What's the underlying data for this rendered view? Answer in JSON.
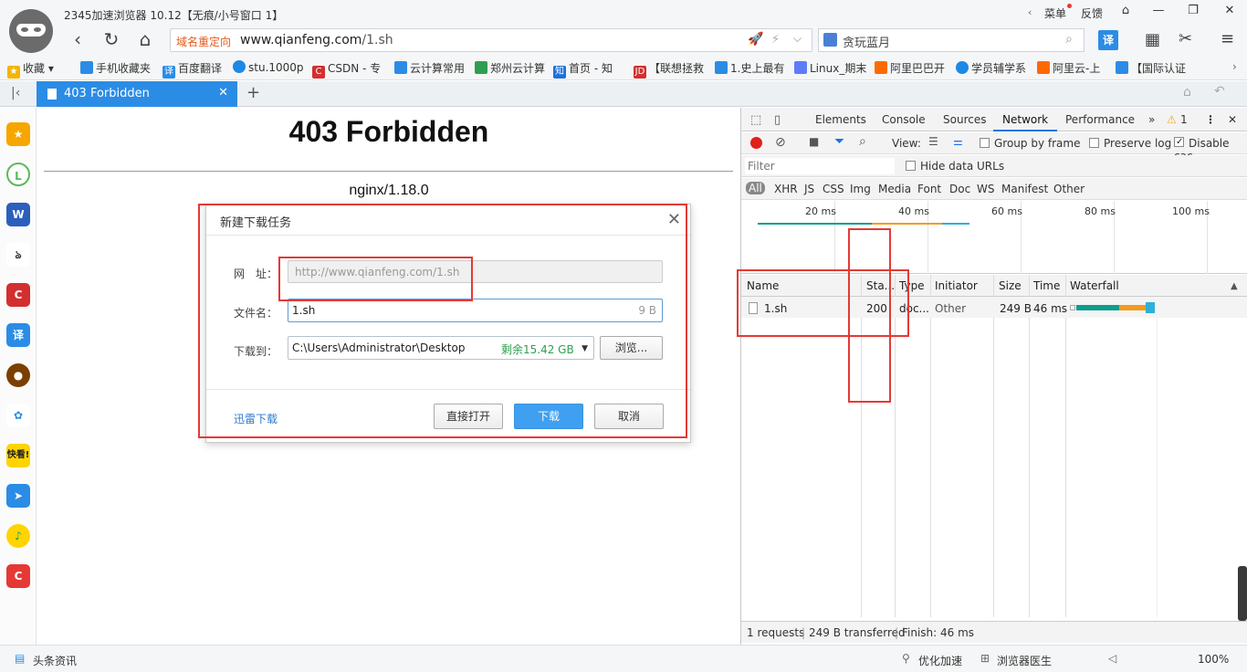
{
  "window": {
    "title": "2345加速浏览器 10.12【无痕/小号窗口 1】",
    "menu_label": "菜单",
    "feedback_label": "反馈"
  },
  "nav": {
    "redirect_badge": "域名重定向",
    "url_host": "www.qianfeng.com",
    "url_path": "/1.sh",
    "search_text": "贪玩蓝月"
  },
  "bookmarks": [
    {
      "label": "收藏",
      "color": "#f5b400"
    },
    {
      "label": "手机收藏夹",
      "color": "#2b8ce6"
    },
    {
      "label": "百度翻译",
      "color": "#2b8ce6"
    },
    {
      "label": "stu.1000p",
      "color": "#1e88e5"
    },
    {
      "label": "CSDN - 专",
      "color": "#d32f2f"
    },
    {
      "label": "云计算常用",
      "color": "#2b8ce6"
    },
    {
      "label": "郑州云计算",
      "color": "#2e9f4f"
    },
    {
      "label": "首页 - 知",
      "color": "#1e6fd9"
    },
    {
      "label": "【联想拯救",
      "color": "#d32f2f"
    },
    {
      "label": "1.史上最有",
      "color": "#2b8ce6"
    },
    {
      "label": "Linux_期末",
      "color": "#5c7cfa"
    },
    {
      "label": "阿里巴巴开",
      "color": "#ff6a00"
    },
    {
      "label": "学员辅学系",
      "color": "#1e88e5"
    },
    {
      "label": "阿里云-上",
      "color": "#ff6a00"
    },
    {
      "label": "【国际认证",
      "color": "#2b8ce6"
    }
  ],
  "tab": {
    "label": "403 Forbidden"
  },
  "page": {
    "heading": "403 Forbidden",
    "server": "nginx/1.18.0"
  },
  "dialog": {
    "title": "新建下载任务",
    "url_label": "网　址：",
    "url_value": "http://www.qianfeng.com/1.sh",
    "filename_label": "文件名：",
    "filename_value": "1.sh",
    "filesize": "9 B",
    "saveto_label": "下载到：",
    "saveto_path": "C:\\Users\\Administrator\\Desktop",
    "free_space": "剩余15.42 GB",
    "browse_label": "浏览...",
    "xunlei_label": "迅雷下载",
    "open_label": "直接打开",
    "download_label": "下载",
    "cancel_label": "取消"
  },
  "devtools": {
    "tabs": [
      "Elements",
      "Console",
      "Sources",
      "Network",
      "Performance"
    ],
    "active_tab": "Network",
    "warning_count": "1",
    "view_label": "View:",
    "group_by_frame": "Group by frame",
    "preserve_log": "Preserve log",
    "disable_cache": "Disable cac",
    "filter_placeholder": "Filter",
    "hide_data_urls": "Hide data URLs",
    "types": [
      "All",
      "XHR",
      "JS",
      "CSS",
      "Img",
      "Media",
      "Font",
      "Doc",
      "WS",
      "Manifest",
      "Other"
    ],
    "ticks": [
      "20 ms",
      "40 ms",
      "60 ms",
      "80 ms",
      "100 ms"
    ],
    "columns": [
      "Name",
      "Sta...",
      "Type",
      "Initiator",
      "Size",
      "Time",
      "Waterfall"
    ],
    "row": {
      "name": "1.sh",
      "status": "200",
      "type": "doc...",
      "initiator": "Other",
      "size": "249 B",
      "time": "46 ms"
    },
    "summary_requests": "1 requests",
    "summary_transferred": "249 B transferred",
    "summary_finish": "Finish: 46 ms"
  },
  "statusbar": {
    "news": "头条资讯",
    "speedup": "优化加速",
    "doctor": "浏览器医生",
    "zoom": "100%"
  }
}
